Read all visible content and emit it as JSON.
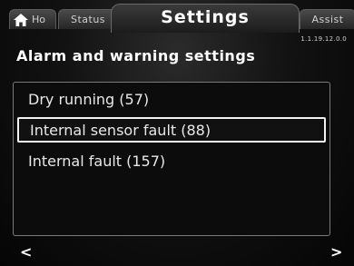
{
  "tabs": {
    "home_label": "Ho",
    "status_label": "Status",
    "settings_label": "Settings",
    "assist_label": "Assist"
  },
  "header": {
    "version": "1.1.19.12.0.0",
    "title": "Alarm and warning settings"
  },
  "list": {
    "items": [
      {
        "label": "Dry running (57)"
      },
      {
        "label": "Internal sensor fault (88)"
      },
      {
        "label": "Internal fault (157)"
      }
    ],
    "selected_index": 1
  },
  "nav": {
    "prev": "<",
    "next": ">"
  },
  "icons": {
    "home": "home-icon"
  }
}
